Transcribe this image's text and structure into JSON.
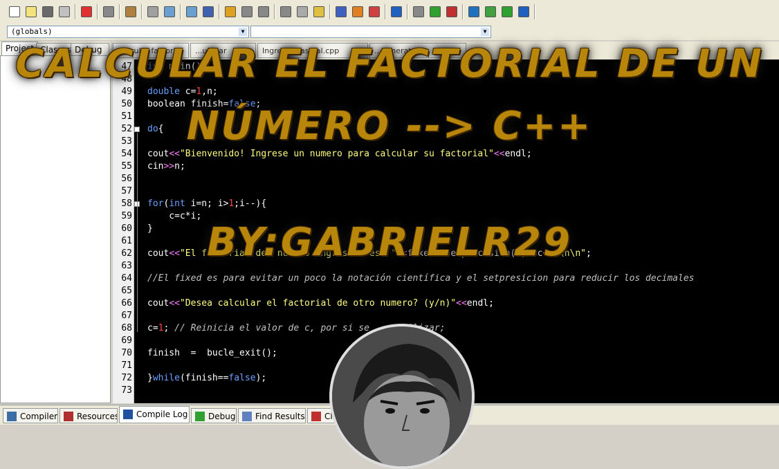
{
  "combos": {
    "scope": "(globals)",
    "member": ""
  },
  "left_tabs": [
    "Project",
    "Classes",
    "Debug"
  ],
  "file_tabs": [
    "Calcular factorial",
    "...uladar",
    "Ingrese mas...al.cpp",
    "...nenerator.c"
  ],
  "code_lines": [
    {
      "n": "47",
      "html": "<span class=\"kw\">int</span> main(){"
    },
    {
      "n": "48",
      "html": ""
    },
    {
      "n": "49",
      "html": "<span class=\"kw\">double</span> c=<span class=\"num\">1</span>,n;"
    },
    {
      "n": "50",
      "html": "boolean finish=<span class=\"kw\">false</span>;"
    },
    {
      "n": "51",
      "html": ""
    },
    {
      "n": "52",
      "html": "<span class=\"kw\">do</span>{",
      "fold": true
    },
    {
      "n": "53",
      "html": ""
    },
    {
      "n": "54",
      "html": "cout<span class=\"op\">&lt;&lt;</span><span class=\"str\">\"Bienvenido! Ingrese un numero para calcular su factorial\"</span><span class=\"op\">&lt;&lt;</span>endl;"
    },
    {
      "n": "55",
      "html": "cin<span class=\"op\">&gt;&gt;</span>n;"
    },
    {
      "n": "56",
      "html": ""
    },
    {
      "n": "57",
      "html": ""
    },
    {
      "n": "58",
      "html": "<span class=\"kw\">for</span>(<span class=\"kw\">int</span> i=n; i&gt;<span class=\"num\">1</span>;i--){",
      "fold": true
    },
    {
      "n": "59",
      "html": "    c=c*i;"
    },
    {
      "n": "60",
      "html": "}"
    },
    {
      "n": "61",
      "html": ""
    },
    {
      "n": "62",
      "html": "cout<span class=\"op\">&lt;&lt;</span><span class=\"str\">\"El factorial del numero ingresado es: \"</span><span class=\"op\">&lt;&lt;</span>fixed<span class=\"op\">&lt;&lt;</span>setprecision(<span class=\"num\">2</span>)<span class=\"op\">&lt;&lt;</span>c<span class=\"op\">&lt;&lt;</span><span class=\"str\">\"\\n\\n\"</span>;"
    },
    {
      "n": "63",
      "html": ""
    },
    {
      "n": "64",
      "html": "<span class=\"cm\">//El fixed es para evitar un poco la notación científica y el setpresicion para reducir los decimales</span>"
    },
    {
      "n": "65",
      "html": ""
    },
    {
      "n": "66",
      "html": "cout<span class=\"op\">&lt;&lt;</span><span class=\"str\">\"Desea calcular el factorial de otro numero? (y/n)\"</span><span class=\"op\">&lt;&lt;</span>endl;"
    },
    {
      "n": "67",
      "html": ""
    },
    {
      "n": "68",
      "html": "c=<span class=\"num\">1</span>; <span class=\"cm\">// Reinicia el valor de c, por si se ... utilizar;</span>"
    },
    {
      "n": "69",
      "html": ""
    },
    {
      "n": "70",
      "html": "finish  =  bucle_exit();"
    },
    {
      "n": "71",
      "html": ""
    },
    {
      "n": "72",
      "html": "}<span class=\"kw\">while</span>(finish==<span class=\"kw\">false</span>);"
    },
    {
      "n": "73",
      "html": ""
    }
  ],
  "bottom_tabs": [
    "Compiler",
    "Resources",
    "Compile Log",
    "Debug",
    "Find Results",
    "Close"
  ],
  "overlay": {
    "line1": "CALCULAR EL FACTORIAL DE UN",
    "line2": "NÚMERO --> C++",
    "line3": "BY:GABRIELR29"
  },
  "colors": {
    "title": "#b8860b",
    "editor_bg": "#000000",
    "keyword": "#6aa0ff",
    "string": "#ffff80"
  }
}
